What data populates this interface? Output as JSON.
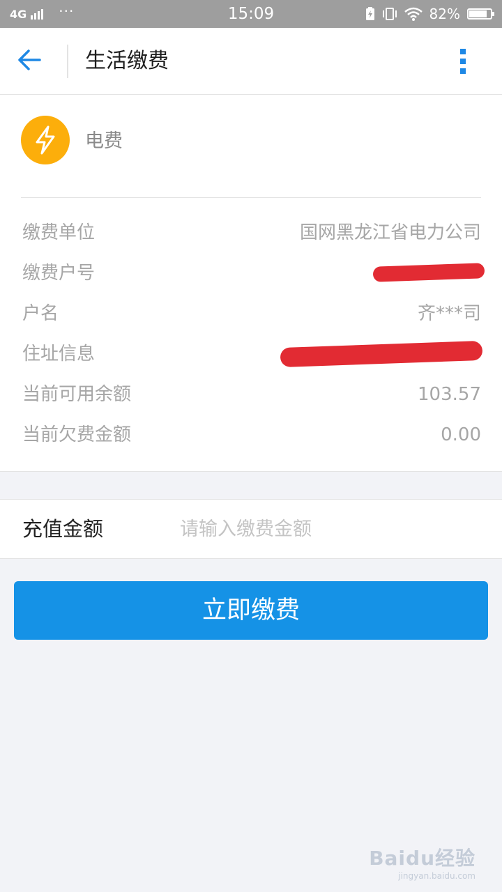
{
  "status_bar": {
    "network": "4G",
    "dots": "···",
    "time": "15:09",
    "battery": "82%",
    "battery_level": 0.82
  },
  "header": {
    "title": "生活缴费"
  },
  "bill": {
    "type": "电费",
    "rows": [
      {
        "label": "缴费单位",
        "value": "国网黑龙江省电力公司"
      },
      {
        "label": "缴费户号",
        "value": ""
      },
      {
        "label": "户名",
        "value": "齐***司"
      },
      {
        "label": "住址信息",
        "value": ""
      },
      {
        "label": "当前可用余额",
        "value": "103.57"
      },
      {
        "label": "当前欠费金额",
        "value": "0.00"
      }
    ]
  },
  "recharge": {
    "label": "充值金额",
    "placeholder": "请输入缴费金额",
    "value": ""
  },
  "pay_button": {
    "label": "立即缴费"
  },
  "watermark": {
    "main": "Baidu经验",
    "sub": "jingyan.baidu.com"
  },
  "colors": {
    "accent": "#1592e6",
    "icon_bg": "#fcae0b",
    "redaction": "#e01b24"
  }
}
